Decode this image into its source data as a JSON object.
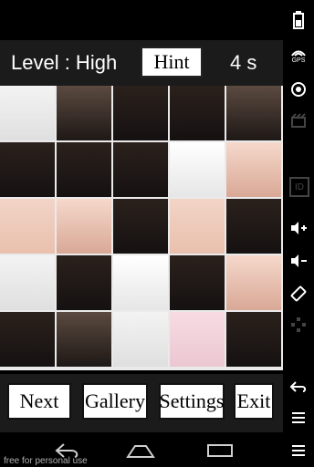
{
  "hud": {
    "level_text": "Level : High",
    "hint_label": "Hint",
    "timer_text": "4 s"
  },
  "actions": {
    "next_label": "Next",
    "gallery_label": "Gallery",
    "settings_label": "Settings",
    "exit_label": "Exit"
  },
  "watermark": {
    "text": "free for personal use"
  },
  "emulator": {
    "gps_label": "GPS",
    "id_label": "ID"
  },
  "icons": [
    "battery-icon",
    "gps-icon",
    "camera-icon",
    "clapperboard-icon",
    "id-icon",
    "volume-up-icon",
    "volume-down-icon",
    "rotate-icon",
    "dpad-icon",
    "back-icon",
    "home-icon",
    "recents-icon",
    "menu-icon"
  ]
}
